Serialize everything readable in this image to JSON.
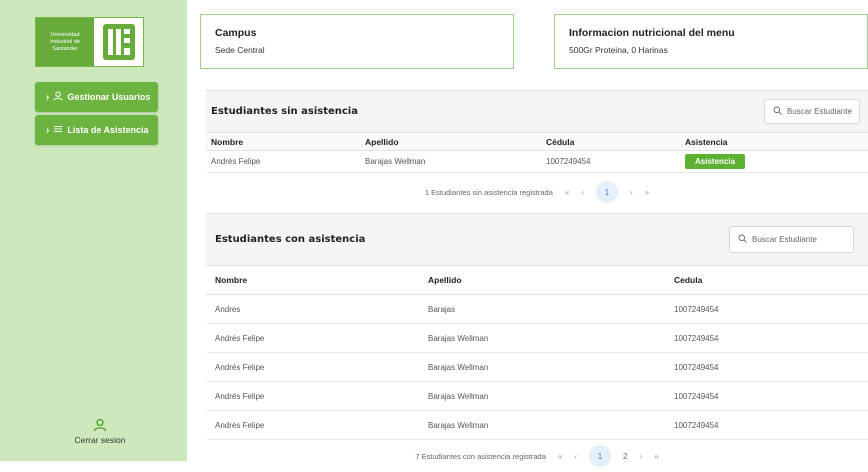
{
  "logo": {
    "text_line1": "Universidad",
    "text_line2": "Industrial de",
    "text_line3": "Santander",
    "mark": "UIS"
  },
  "sidebar": {
    "items": [
      {
        "label": "Gestionar Usuarios",
        "icon": "user-icon"
      },
      {
        "label": "Lista de Asistencia",
        "icon": "list-icon"
      }
    ],
    "logout_label": "Cerrar sesion"
  },
  "cards": {
    "campus": {
      "title": "Campus",
      "value": "Sede Central"
    },
    "menu": {
      "title": "Informacion nutricional del menu",
      "value": "500Gr Proteina, 0 Harinas"
    }
  },
  "absent": {
    "title": "Estudiantes sin asistencia",
    "search_placeholder": "Buscar Estudiante",
    "columns": [
      "Nombre",
      "Apellido",
      "Cédula",
      "Asistencia"
    ],
    "rows": [
      {
        "nombre": "Andrés Felipe",
        "apellido": "Barajas Wellman",
        "cedula": "1007249454",
        "action": "Asistencia"
      }
    ],
    "footer": "1 Estudiantes sin asistencia registrada",
    "pager": {
      "first": "«",
      "prev": "‹",
      "current": "1",
      "next": "›",
      "last": "»"
    }
  },
  "present": {
    "title": "Estudiantes con asistencia",
    "search_placeholder": "Buscar Estudiante",
    "columns": [
      "Nombre",
      "Apellido",
      "Cedula"
    ],
    "rows": [
      {
        "nombre": "Andres",
        "apellido": "Barajas",
        "cedula": "1007249454"
      },
      {
        "nombre": "Andrés Felipe",
        "apellido": "Barajas Wellman",
        "cedula": "1007249454"
      },
      {
        "nombre": "Andrés Felipe",
        "apellido": "Barajas Wellman",
        "cedula": "1007249454"
      },
      {
        "nombre": "Andrés Felipe",
        "apellido": "Barajas Wellman",
        "cedula": "1007249454"
      },
      {
        "nombre": "Andrés Felipe",
        "apellido": "Barajas Wellman",
        "cedula": "1007249454"
      }
    ],
    "footer": "7 Estudiantes con asistencia registrada",
    "pager": {
      "first": "«",
      "prev": "‹",
      "current": "1",
      "page2": "2",
      "next": "›",
      "last": "»"
    }
  },
  "colors": {
    "sidebar_bg": "#cde8bb",
    "accent": "#6db33f",
    "badge": "#5cb230",
    "pager_active": "#3b7ed9"
  }
}
